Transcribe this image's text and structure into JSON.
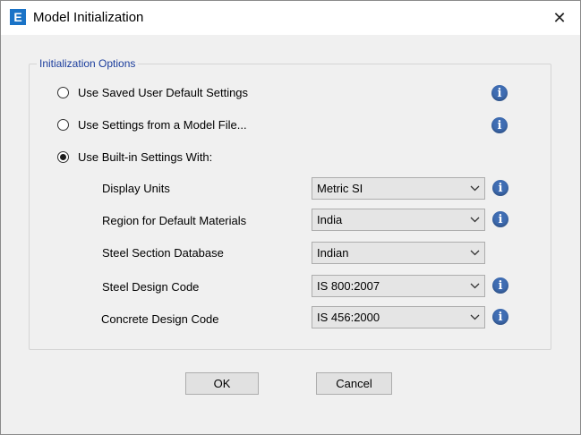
{
  "window": {
    "title": "Model Initialization",
    "app_icon_letter": "E",
    "close_glyph": "✕"
  },
  "group": {
    "label": "Initialization Options"
  },
  "options": [
    {
      "label": "Use Saved User Default Settings",
      "selected": false
    },
    {
      "label": "Use Settings from a Model File...",
      "selected": false
    },
    {
      "label": "Use Built-in Settings With:",
      "selected": true
    }
  ],
  "settings": [
    {
      "label": "Display Units",
      "value": "Metric SI",
      "has_info": true
    },
    {
      "label": "Region for Default Materials",
      "value": "India",
      "has_info": true
    },
    {
      "label": "Steel Section Database",
      "value": "Indian",
      "has_info": false
    },
    {
      "label": "Steel Design Code",
      "value": "IS 800:2007",
      "has_info": true
    },
    {
      "label": "Concrete Design Code",
      "value": "IS 456:2000",
      "has_info": true
    }
  ],
  "info_glyph": "i",
  "buttons": {
    "ok": "OK",
    "cancel": "Cancel"
  },
  "icons": {
    "info": "info-icon",
    "chevron": "chevron-down-icon",
    "close": "close-icon"
  },
  "colors": {
    "group_label": "#1a3c9c",
    "info_icon": "#3f6db3",
    "app_icon": "#1a73c7"
  }
}
